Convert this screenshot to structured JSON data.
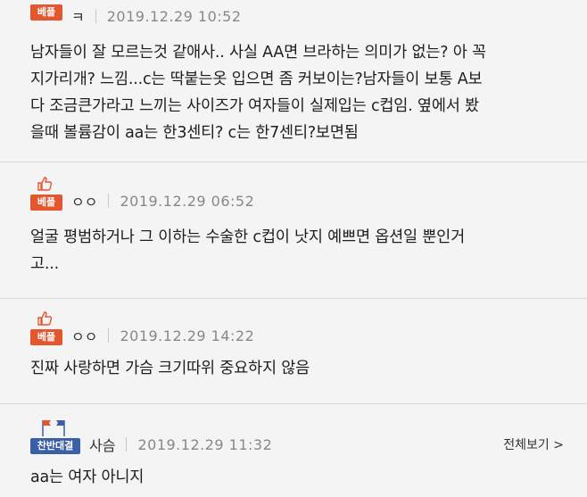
{
  "comments": [
    {
      "badge": "베플",
      "nick": "ㅋ",
      "date": "2019.12.29 10:52",
      "body": "남자들이 잘 모르는것 같애사.. 사실 AA면 브라하는 의미가 없는? 아 꼭\n지가리개? 느낌...c는 딱붙는옷 입으면 좀 커보이는?남자들이 보통 A보\n다 조금큰가라고 느끼는 사이즈가 여자들이 실제입는 c컵임. 옆에서 봤\n을때 볼륨감이 aa는 한3센티? c는 한7센티?보면됨"
    },
    {
      "badge": "베플",
      "nick": "ㅇㅇ",
      "date": "2019.12.29 06:52",
      "body": "얼굴 평범하거나 그 이하는 수술한 c컵이 낫지 예쁘면 옵션일 뿐인거\n고..."
    },
    {
      "badge": "베플",
      "nick": "ㅇㅇ",
      "date": "2019.12.29 14:22",
      "body": "진짜 사랑하면 가슴 크기따위 중요하지 않음"
    },
    {
      "badge": "찬반대결",
      "nick": "사슴",
      "date": "2019.12.29 11:32",
      "more": "전체보기 >",
      "body": "aa는 여자 아니지"
    }
  ],
  "colors": {
    "best_badge": "#e4572e",
    "vs_badge": "#3b5ea9"
  },
  "icons": {
    "best": "thumbs-up-icon",
    "vs": "flags-icon"
  }
}
